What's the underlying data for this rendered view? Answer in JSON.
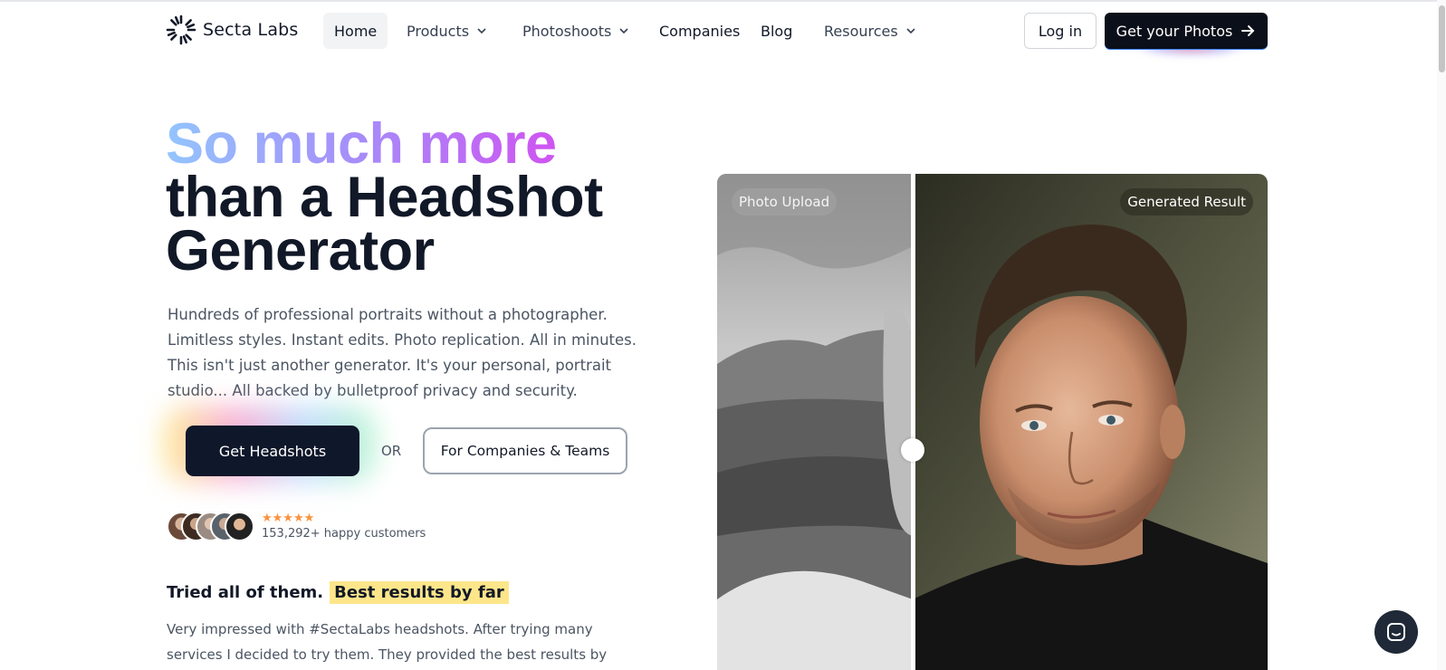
{
  "brand": {
    "name": "Secta Labs"
  },
  "nav": {
    "items": [
      {
        "label": "Home"
      },
      {
        "label": "Products"
      },
      {
        "label": "Photoshoots"
      },
      {
        "label": "Companies"
      },
      {
        "label": "Blog"
      },
      {
        "label": "Resources"
      }
    ],
    "login": "Log in",
    "cta": "Get your Photos"
  },
  "hero": {
    "title_highlight": "So much more",
    "title_line2": "than a Headshot",
    "title_line3": "Generator",
    "subtitle": "Hundreds of professional portraits without a photographer. Limitless styles. Instant edits. Photo replication. All in minutes. This isn't just another generator. It's your personal, portrait studio... All backed by bulletproof privacy and security.",
    "primary_button": "Get Headshots",
    "or_text": "OR",
    "secondary_button": "For Companies & Teams",
    "stars": "★★★★★",
    "customers": "153,292+ happy customers"
  },
  "testimonial": {
    "title": "Tried all of them.",
    "highlight": "Best results by far",
    "quote": "Very impressed with #SectaLabs headshots. After trying many services I decided to try them. They provided the best results by far! If you're"
  },
  "comparison": {
    "left_label": "Photo Upload",
    "right_label": "Generated Result"
  },
  "colors": {
    "dark": "#0f172a",
    "gradient_start": "#93c5fd",
    "gradient_mid": "#a78bfa",
    "gradient_end": "#d946ef",
    "highlight": "#fde68a",
    "stars": "#fb923c"
  },
  "icons": [
    "logo-spinner-icon",
    "chevron-down-icon",
    "arrow-right-icon",
    "chat-icon"
  ]
}
